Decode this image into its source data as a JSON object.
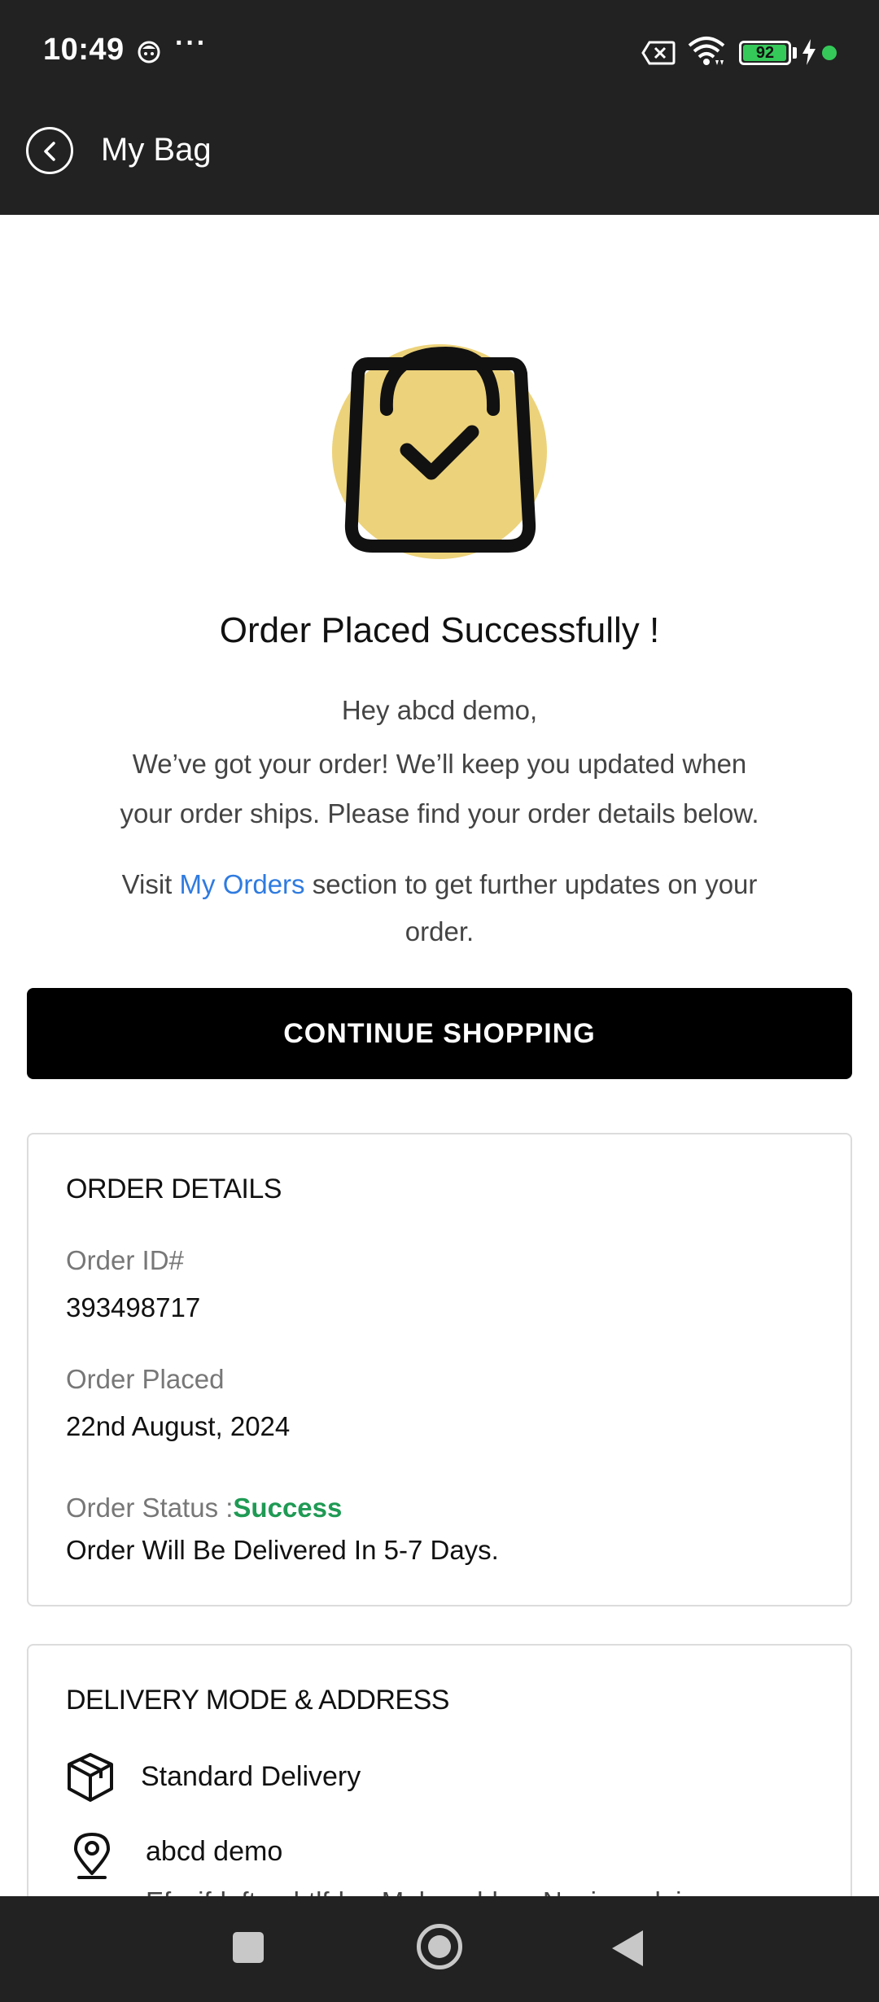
{
  "status_bar": {
    "time": "10:49",
    "dots": "···",
    "battery_level": "92",
    "icons": [
      "face-icon",
      "sim-icon",
      "wifi-icon",
      "battery-icon",
      "charging-bolt-icon"
    ]
  },
  "header": {
    "title": "My Bag",
    "back_icon": "chevron-left-icon"
  },
  "hero": {
    "title": "Order Placed Successfully !",
    "greeting": "Hey abcd demo,",
    "message_line1": "We’ve got your order! We’ll keep you updated when",
    "message_line2": "your order ships. Please find your order details below.",
    "visit_prefix": "Visit ",
    "visit_link": "My Orders",
    "visit_suffix": " section to get further updates on your order.",
    "illustration": "shopping-bag-check-icon"
  },
  "continue_button": "CONTINUE SHOPPING",
  "order_details": {
    "title": "ORDER DETAILS",
    "order_id_label": "Order ID#",
    "order_id": "393498717",
    "order_placed_label": "Order Placed",
    "order_placed": "22nd August, 2024",
    "order_status_label": "Order Status :",
    "order_status": "Success",
    "delivery_note": "Order Will Be Delivered In 5-7 Days."
  },
  "delivery": {
    "title": "DELIVERY MODE & ADDRESS",
    "mode": "Standard Delivery",
    "name": "abcd demo",
    "address_partial": "Efsvifdnftsadrtlfdm, Mahwaddan, Nasiwandain"
  },
  "colors": {
    "header_bg": "#222222",
    "link": "#2f7be0",
    "success": "#1f9a54",
    "bag_circle": "#ecd27a",
    "button_bg": "#000000"
  }
}
